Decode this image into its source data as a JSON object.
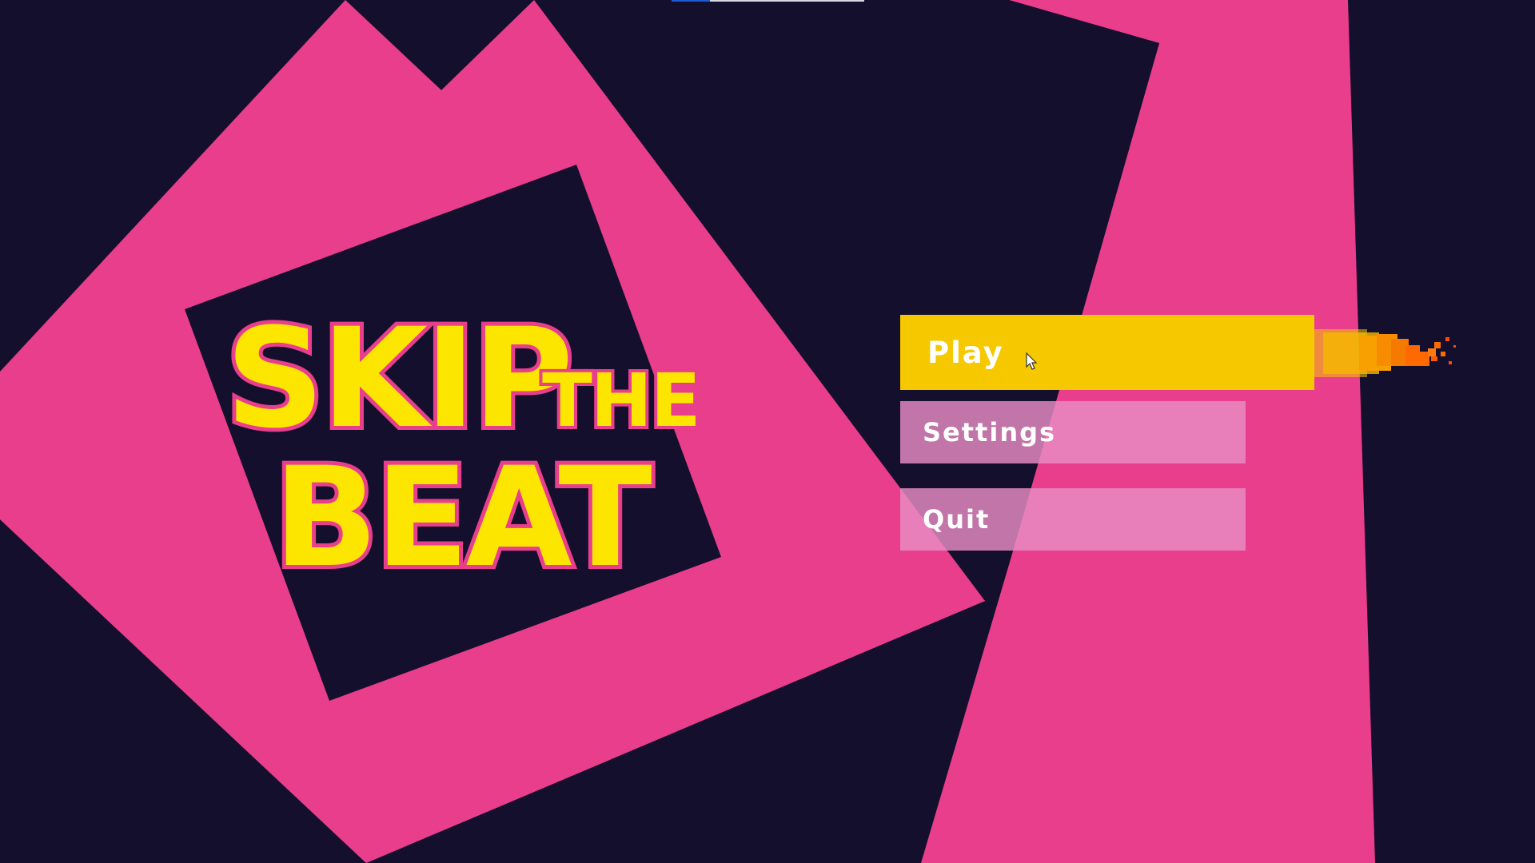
{
  "game": {
    "logo_text": "SKIP THE BEAT",
    "logo_line1": "SKIP",
    "logo_line2": "THE",
    "logo_line3": "BEAT"
  },
  "menu": {
    "items": [
      {
        "label": "Play",
        "state": "selected"
      },
      {
        "label": "Settings",
        "state": "normal"
      },
      {
        "label": "Quit",
        "state": "normal"
      }
    ]
  },
  "colors": {
    "background": "#140f2d",
    "accent_pink": "#e83e8c",
    "logo_yellow": "#fce600",
    "selected_button": "#f5c800",
    "unselected_button": "#e88cc4"
  },
  "icons": {
    "cursor": "arrow-cursor-icon",
    "trail": "pixel-fire-trail"
  }
}
